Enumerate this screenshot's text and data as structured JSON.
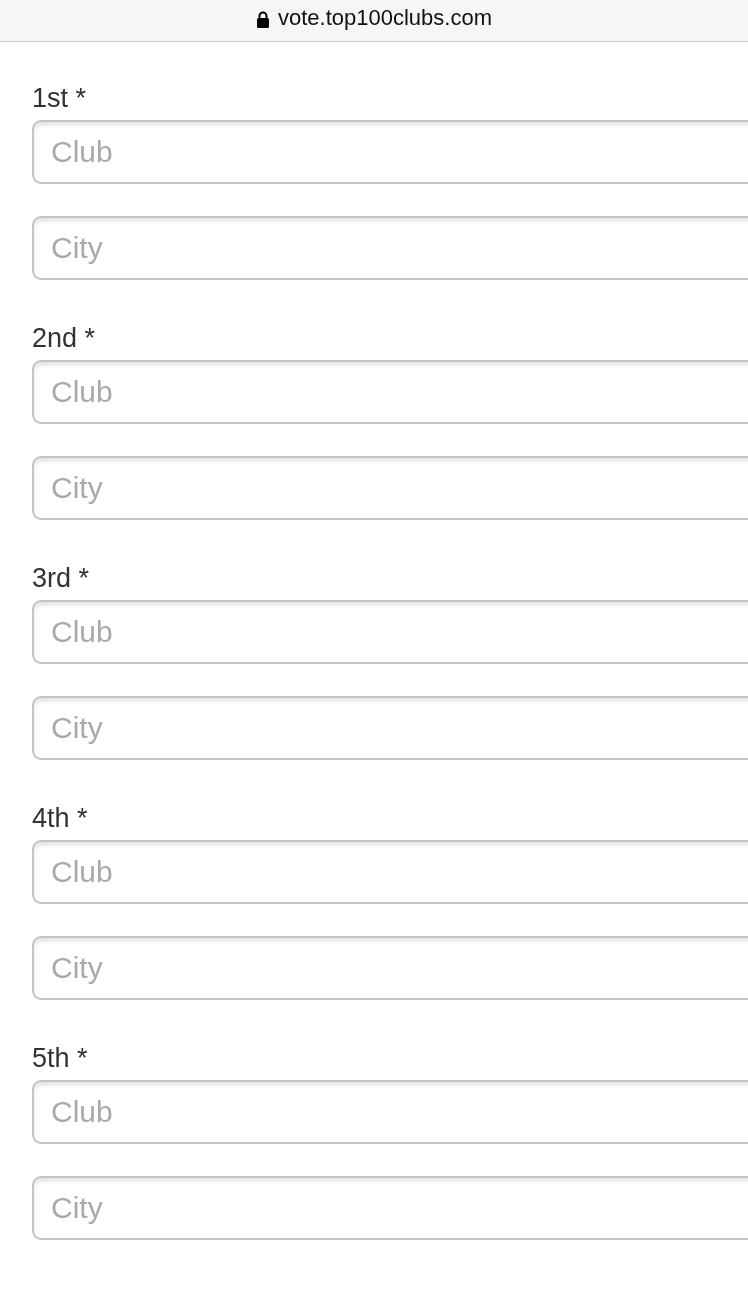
{
  "address_bar": {
    "url": "vote.top100clubs.com"
  },
  "ranks": [
    {
      "label": "1st *",
      "fields": [
        {
          "placeholder": "Club"
        },
        {
          "placeholder": "City"
        }
      ]
    },
    {
      "label": "2nd *",
      "fields": [
        {
          "placeholder": "Club"
        },
        {
          "placeholder": "City"
        }
      ]
    },
    {
      "label": "3rd *",
      "fields": [
        {
          "placeholder": "Club"
        },
        {
          "placeholder": "City"
        }
      ]
    },
    {
      "label": "4th *",
      "fields": [
        {
          "placeholder": "Club"
        },
        {
          "placeholder": "City"
        }
      ]
    },
    {
      "label": "5th *",
      "fields": [
        {
          "placeholder": "Club"
        },
        {
          "placeholder": "City"
        }
      ]
    }
  ]
}
